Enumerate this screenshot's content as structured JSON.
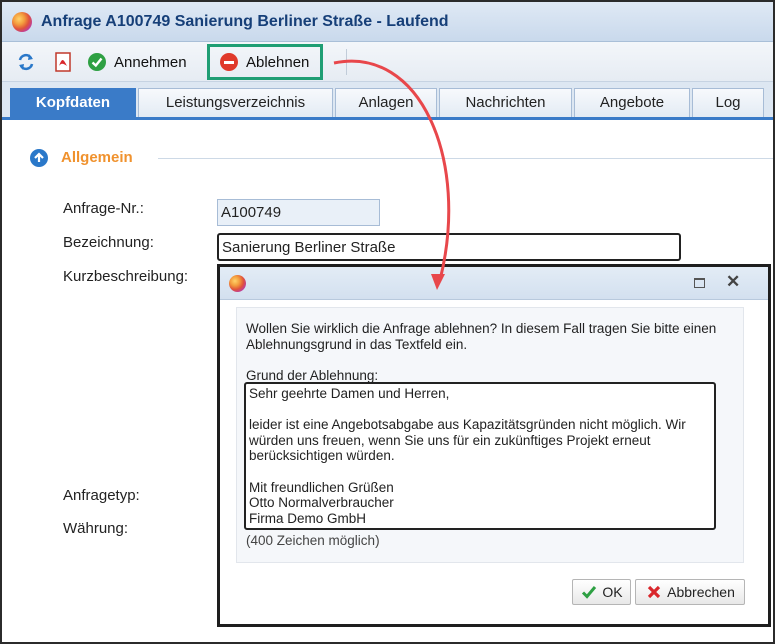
{
  "window": {
    "title": "Anfrage A100749 Sanierung Berliner Straße - Laufend"
  },
  "toolbar": {
    "accept_label": "Annehmen",
    "reject_label": "Ablehnen"
  },
  "tabs": [
    {
      "label": "Kopfdaten"
    },
    {
      "label": "Leistungsverzeichnis"
    },
    {
      "label": "Anlagen"
    },
    {
      "label": "Nachrichten"
    },
    {
      "label": "Angebote"
    },
    {
      "label": "Log"
    }
  ],
  "section": {
    "title": "Allgemein"
  },
  "form": {
    "anfrage_nr_label": "Anfrage-Nr.:",
    "anfrage_nr_value": "A100749",
    "bezeichnung_label": "Bezeichnung:",
    "bezeichnung_value": "Sanierung Berliner Straße",
    "kurzbeschreibung_label": "Kurzbeschreibung:",
    "anfragetyp_label": "Anfragetyp:",
    "waehrung_label": "Währung:"
  },
  "dialog": {
    "message": "Wollen Sie wirklich die Anfrage ablehnen? In diesem Fall tragen Sie bitte einen Ablehnungsgrund in das Textfeld ein.",
    "reason_label": "Grund der Ablehnung:",
    "reason_text": "Sehr geehrte Damen und Herren,\n\nleider ist eine Angebotsabgabe aus Kapazitätsgründen nicht möglich. Wir würden uns freuen, wenn Sie uns für ein zukünftiges Projekt erneut berücksichtigen würden.\n\nMit freundlichen Grüßen\nOtto Normalverbraucher\nFirma Demo GmbH",
    "char_hint": "(400 Zeichen möglich)",
    "ok_label": "OK",
    "cancel_label": "Abbrechen"
  },
  "colors": {
    "accent": "#3a7bc8",
    "section_title": "#f0922e",
    "highlight": "#1f9e74",
    "arrow": "#e8474b"
  }
}
